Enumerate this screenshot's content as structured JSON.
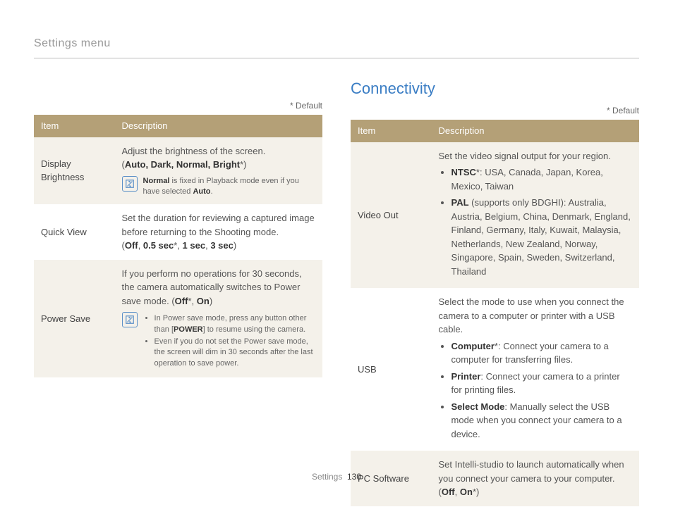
{
  "header": "Settings menu",
  "default_label": "* Default",
  "table_headers": {
    "item": "Item",
    "description": "Description"
  },
  "left": {
    "rows": [
      {
        "item": "Display Brightness",
        "lead": "Adjust the brightness of the screen.",
        "options_prefix": "(",
        "options": "Auto, Dark, Normal, Bright",
        "options_suffix": "*)",
        "note_single_a": "Normal",
        "note_single_b": " is fixed in Playback mode even if you have selected ",
        "note_single_c": "Auto",
        "note_single_d": "."
      },
      {
        "item": "Quick View",
        "lead": "Set the duration for reviewing a captured image before returning to the Shooting mode.",
        "options_prefix": "(",
        "opt1": "Off",
        "sep1": ", ",
        "opt2": "0.5 sec",
        "star2": "*",
        "sep2": ", ",
        "opt3": "1 sec",
        "sep3": ", ",
        "opt4": "3 sec",
        "options_suffix": ")"
      },
      {
        "item": "Power Save",
        "lead": "If you perform no operations for 30 seconds, the camera automatically switches to Power save mode. (",
        "opt_off": "Off",
        "star_off": "*",
        "sep": ", ",
        "opt_on": "On",
        "close": ")",
        "note1_a": "In Power save mode, press any button other than [",
        "note1_b": "POWER",
        "note1_c": "] to resume using the camera.",
        "note2": "Even if you do not set the Power save mode, the screen will dim in 30 seconds after the last operation to save power."
      }
    ]
  },
  "right": {
    "title": "Connectivity",
    "rows": [
      {
        "item": "Video Out",
        "lead": "Set the video signal output for your region.",
        "b1_label": "NTSC",
        "b1_star": "*",
        "b1_text": ": USA, Canada, Japan, Korea, Mexico, Taiwan",
        "b2_label": "PAL",
        "b2_text": " (supports only BDGHI): Australia, Austria, Belgium, China, Denmark, England, Finland, Germany, Italy, Kuwait, Malaysia, Netherlands, New Zealand, Norway, Singapore, Spain, Sweden, Switzerland, Thailand"
      },
      {
        "item": "USB",
        "lead": "Select the mode to use when you connect the camera to a computer or printer with a USB cable.",
        "b1_label": "Computer",
        "b1_star": "*",
        "b1_text": ": Connect your camera to a computer for transferring files.",
        "b2_label": "Printer",
        "b2_text": ": Connect your camera to a printer for printing files.",
        "b3_label": "Select Mode",
        "b3_text": ": Manually select the USB mode when you connect your camera to a device."
      },
      {
        "item": "PC Software",
        "lead_a": "Set Intelli-studio to launch automatically when you connect your camera to your computer. (",
        "opt_off": "Off",
        "sep": ", ",
        "opt_on": "On",
        "star_on": "*",
        "close": ")"
      }
    ]
  },
  "footer": {
    "section": "Settings",
    "page": "130"
  }
}
